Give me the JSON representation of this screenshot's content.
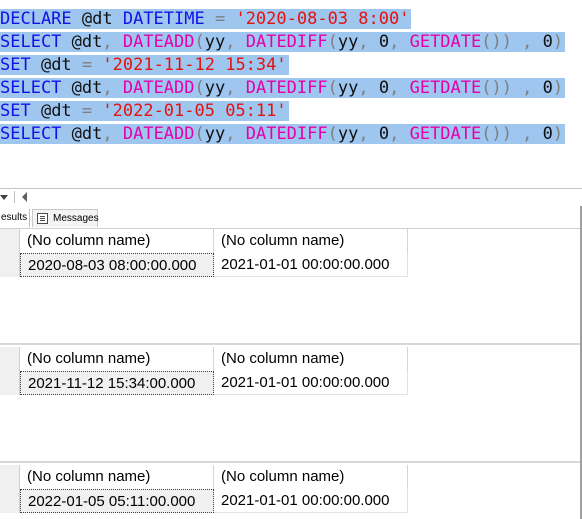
{
  "editor": {
    "lines": [
      [
        {
          "t": "DECLARE",
          "c": "kw"
        },
        {
          "t": " @dt ",
          "c": "tx"
        },
        {
          "t": "DATETIME",
          "c": "kw"
        },
        {
          "t": " = ",
          "c": "op"
        },
        {
          "t": "'2020-08-03 8:00'",
          "c": "str"
        }
      ],
      [
        {
          "t": "SELECT",
          "c": "kw"
        },
        {
          "t": " @dt",
          "c": "tx"
        },
        {
          "t": ", ",
          "c": "op"
        },
        {
          "t": "DATEADD",
          "c": "fn"
        },
        {
          "t": "(",
          "c": "op"
        },
        {
          "t": "yy",
          "c": "tx"
        },
        {
          "t": ", ",
          "c": "op"
        },
        {
          "t": "DATEDIFF",
          "c": "fn"
        },
        {
          "t": "(",
          "c": "op"
        },
        {
          "t": "yy",
          "c": "tx"
        },
        {
          "t": ", ",
          "c": "op"
        },
        {
          "t": "0",
          "c": "num"
        },
        {
          "t": ", ",
          "c": "op"
        },
        {
          "t": "GETDATE",
          "c": "fn"
        },
        {
          "t": "()) , ",
          "c": "op"
        },
        {
          "t": "0",
          "c": "num"
        },
        {
          "t": ")",
          "c": "op"
        }
      ],
      [
        {
          "t": "SET",
          "c": "kw"
        },
        {
          "t": " @dt ",
          "c": "tx"
        },
        {
          "t": "= ",
          "c": "op"
        },
        {
          "t": "'2021-11-12 15:34'",
          "c": "str"
        }
      ],
      [
        {
          "t": "SELECT",
          "c": "kw"
        },
        {
          "t": " @dt",
          "c": "tx"
        },
        {
          "t": ", ",
          "c": "op"
        },
        {
          "t": "DATEADD",
          "c": "fn"
        },
        {
          "t": "(",
          "c": "op"
        },
        {
          "t": "yy",
          "c": "tx"
        },
        {
          "t": ", ",
          "c": "op"
        },
        {
          "t": "DATEDIFF",
          "c": "fn"
        },
        {
          "t": "(",
          "c": "op"
        },
        {
          "t": "yy",
          "c": "tx"
        },
        {
          "t": ", ",
          "c": "op"
        },
        {
          "t": "0",
          "c": "num"
        },
        {
          "t": ", ",
          "c": "op"
        },
        {
          "t": "GETDATE",
          "c": "fn"
        },
        {
          "t": "()) , ",
          "c": "op"
        },
        {
          "t": "0",
          "c": "num"
        },
        {
          "t": ")",
          "c": "op"
        }
      ],
      [
        {
          "t": "SET",
          "c": "kw"
        },
        {
          "t": " @dt ",
          "c": "tx"
        },
        {
          "t": "= ",
          "c": "op"
        },
        {
          "t": "'2022-01-05 05:11'",
          "c": "str"
        }
      ],
      [
        {
          "t": "SELECT",
          "c": "kw"
        },
        {
          "t": " @dt",
          "c": "tx"
        },
        {
          "t": ", ",
          "c": "op"
        },
        {
          "t": "DATEADD",
          "c": "fn"
        },
        {
          "t": "(",
          "c": "op"
        },
        {
          "t": "yy",
          "c": "tx"
        },
        {
          "t": ", ",
          "c": "op"
        },
        {
          "t": "DATEDIFF",
          "c": "fn"
        },
        {
          "t": "(",
          "c": "op"
        },
        {
          "t": "yy",
          "c": "tx"
        },
        {
          "t": ", ",
          "c": "op"
        },
        {
          "t": "0",
          "c": "num"
        },
        {
          "t": ", ",
          "c": "op"
        },
        {
          "t": "GETDATE",
          "c": "fn"
        },
        {
          "t": "()) , ",
          "c": "op"
        },
        {
          "t": "0",
          "c": "num"
        },
        {
          "t": ")",
          "c": "op"
        }
      ]
    ],
    "colors": {
      "keyword": "#1212e6",
      "function": "#e600ac",
      "string": "#e6120f",
      "operator": "#7f7f7f",
      "selection": "#9ec6ef"
    }
  },
  "tabs": {
    "results_label": "esults",
    "messages_label": "Messages"
  },
  "grids": [
    {
      "headers": [
        "(No column name)",
        "(No column name)"
      ],
      "row": [
        "2020-08-03 08:00:00.000",
        "2021-01-01 00:00:00.000"
      ]
    },
    {
      "headers": [
        "(No column name)",
        "(No column name)"
      ],
      "row": [
        "2021-11-12 15:34:00.000",
        "2021-01-01 00:00:00.000"
      ]
    },
    {
      "headers": [
        "(No column name)",
        "(No column name)"
      ],
      "row": [
        "2022-01-05 05:11:00.000",
        "2021-01-01 00:00:00.000"
      ]
    }
  ]
}
